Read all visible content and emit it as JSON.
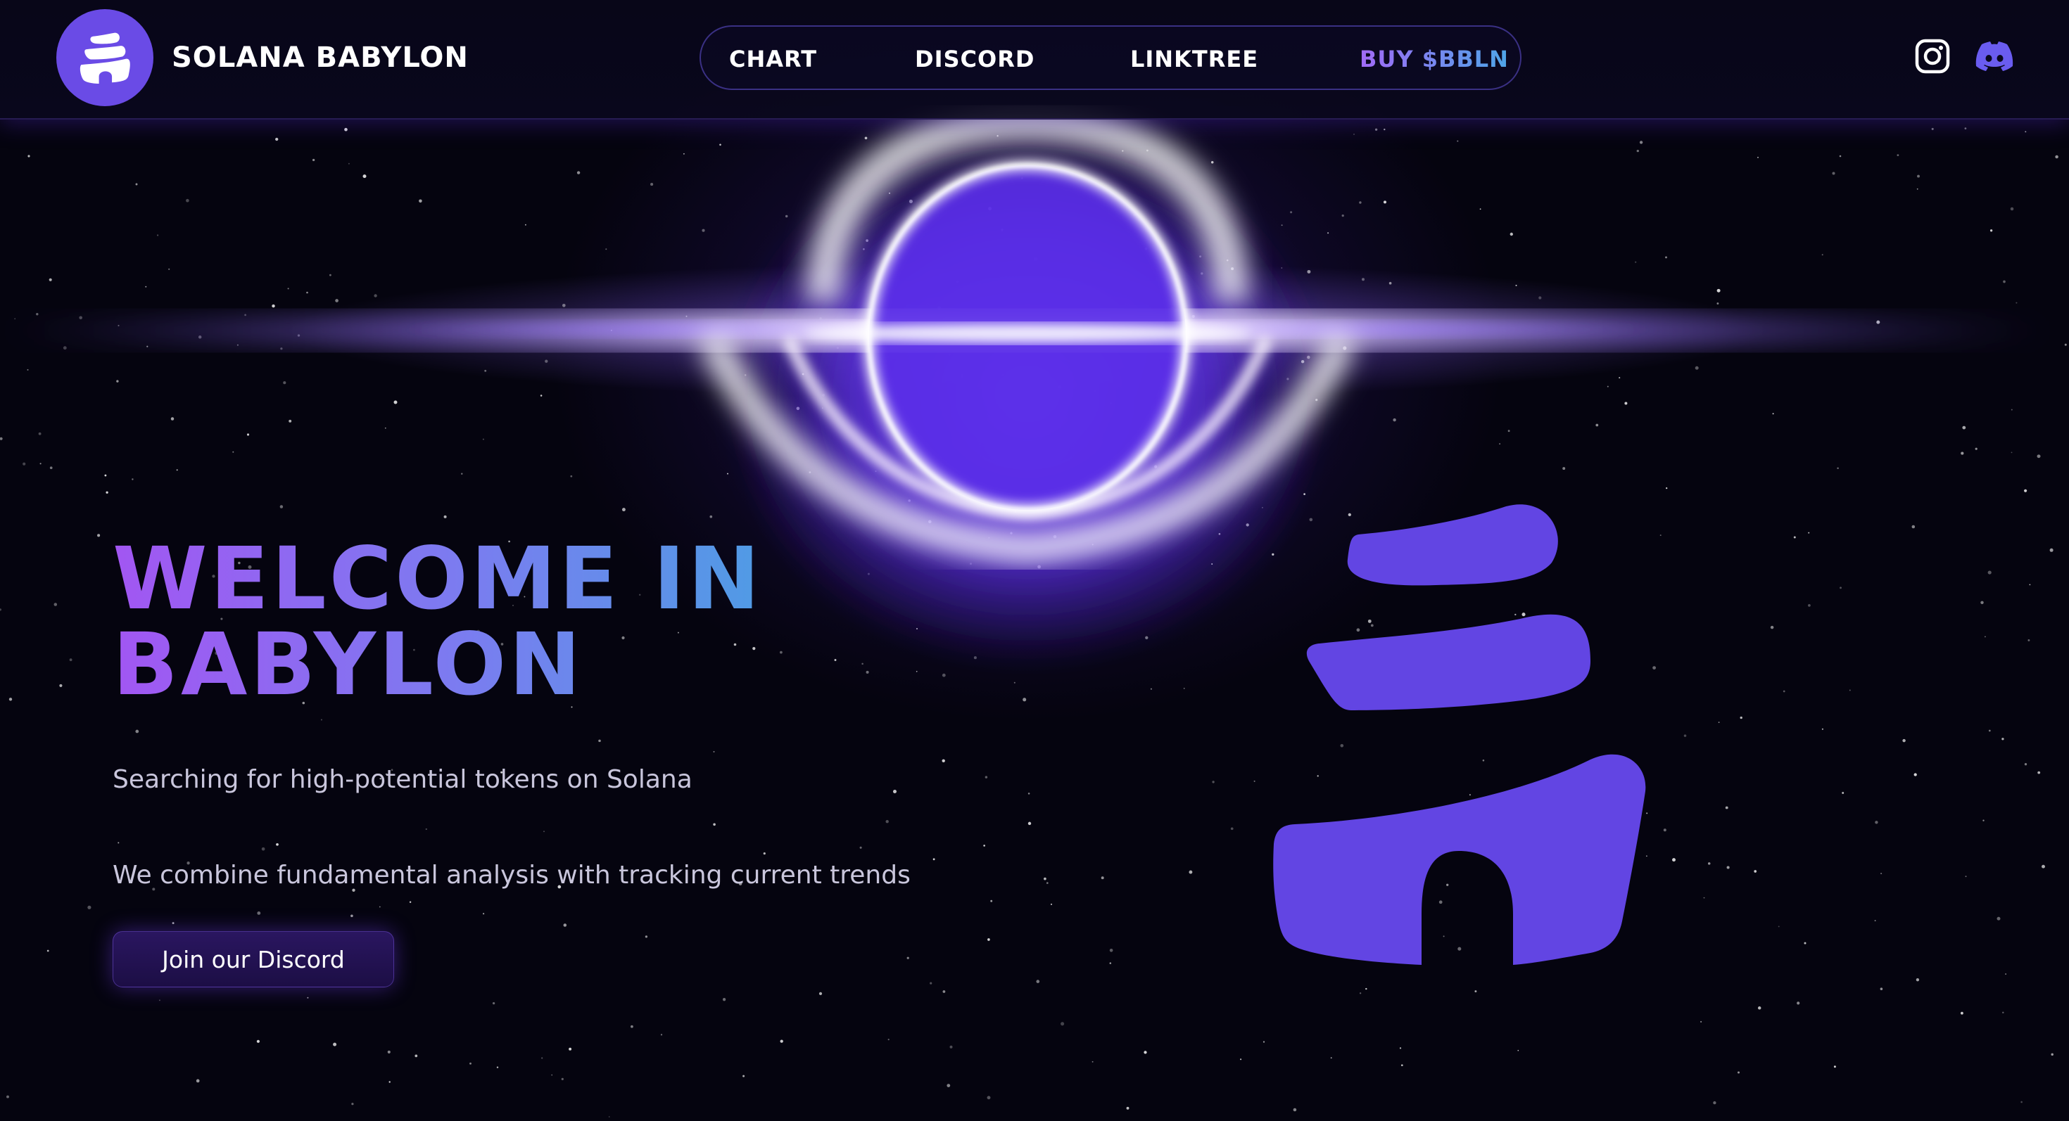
{
  "header": {
    "brand_name": "SOLANA BABYLON",
    "logo_icon": "babylon-stack-logo-icon",
    "nav": [
      {
        "label": "CHART"
      },
      {
        "label": "DISCORD"
      },
      {
        "label": "LINKTREE"
      },
      {
        "label": "BUY $BBLN"
      }
    ],
    "social_icons": [
      "instagram-icon",
      "discord-icon"
    ]
  },
  "hero": {
    "title_line1": "WELCOME IN",
    "title_line2": "BABYLON",
    "tagline": "Searching for high-potential tokens on Solana",
    "description": "We combine fundamental analysis with tracking current trends",
    "cta_label": "Join our Discord"
  },
  "colors": {
    "background": "#05040f",
    "accent": "#6a4be6",
    "gradient_start": "#a256f2",
    "gradient_end": "#3ea8e0",
    "text_muted": "#c9c6dc"
  }
}
